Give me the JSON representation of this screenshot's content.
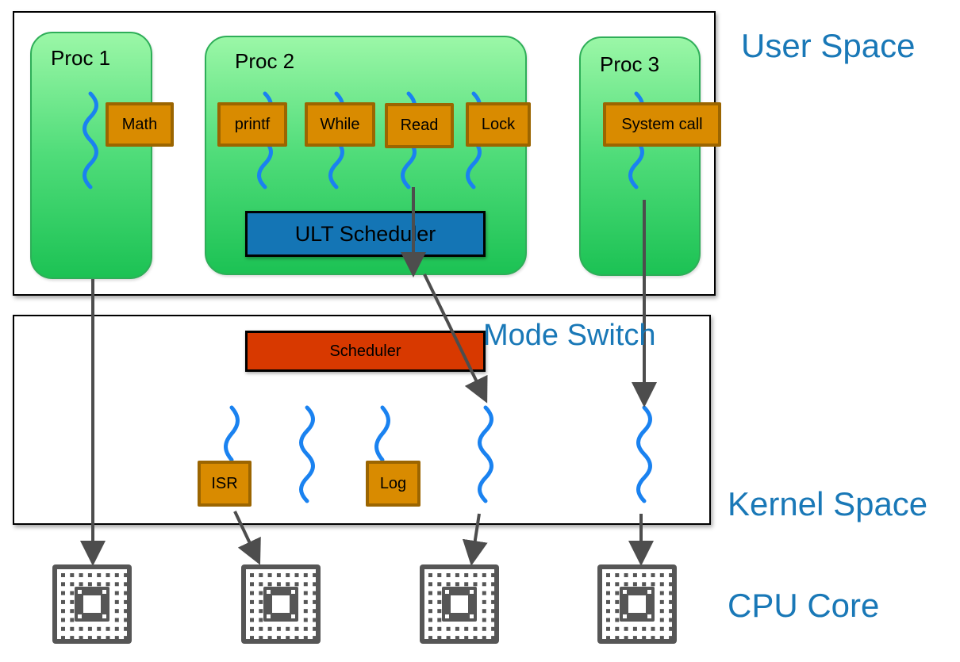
{
  "regions": {
    "user_space": "User Space",
    "mode_switch": "Mode Switch",
    "kernel_space": "Kernel Space",
    "cpu_core": "CPU Core"
  },
  "processes": [
    {
      "label": "Proc 1",
      "tasks": [
        "Math"
      ]
    },
    {
      "label": "Proc 2",
      "tasks": [
        "printf",
        "While",
        "Read",
        "Lock"
      ],
      "scheduler": "ULT Scheduler"
    },
    {
      "label": "Proc 3",
      "tasks": [
        "System call"
      ]
    }
  ],
  "kernel": {
    "scheduler": "Scheduler",
    "tasks": [
      "ISR",
      "Log"
    ]
  },
  "colors": {
    "region_label": "#1978b7",
    "thread": "#1a82f0",
    "task_fill": "#d98b00",
    "task_border": "#9b6500",
    "ult_scheduler": "#1475b5",
    "kernel_scheduler": "#d83900",
    "arrow": "#4d4d4d",
    "proc_green": "#1cc254"
  }
}
